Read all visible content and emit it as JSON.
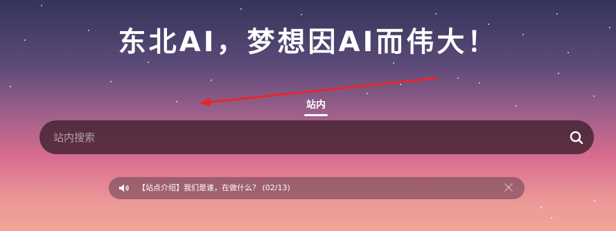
{
  "header": {
    "title": "东北AI，梦想因AI而伟大！"
  },
  "tabs": [
    {
      "label": "站内",
      "active": true
    }
  ],
  "search": {
    "placeholder": "站内搜索",
    "value": ""
  },
  "notice": {
    "text": "【站点介绍】我们是谁，在做什么？ (02/13)"
  },
  "colors": {
    "annotation_arrow": "#e8262a",
    "search_bg": "#3c1e2d",
    "notice_bg": "#82505f"
  },
  "icons": {
    "search": "search-icon",
    "notice": "speaker-icon",
    "close": "close-icon"
  }
}
